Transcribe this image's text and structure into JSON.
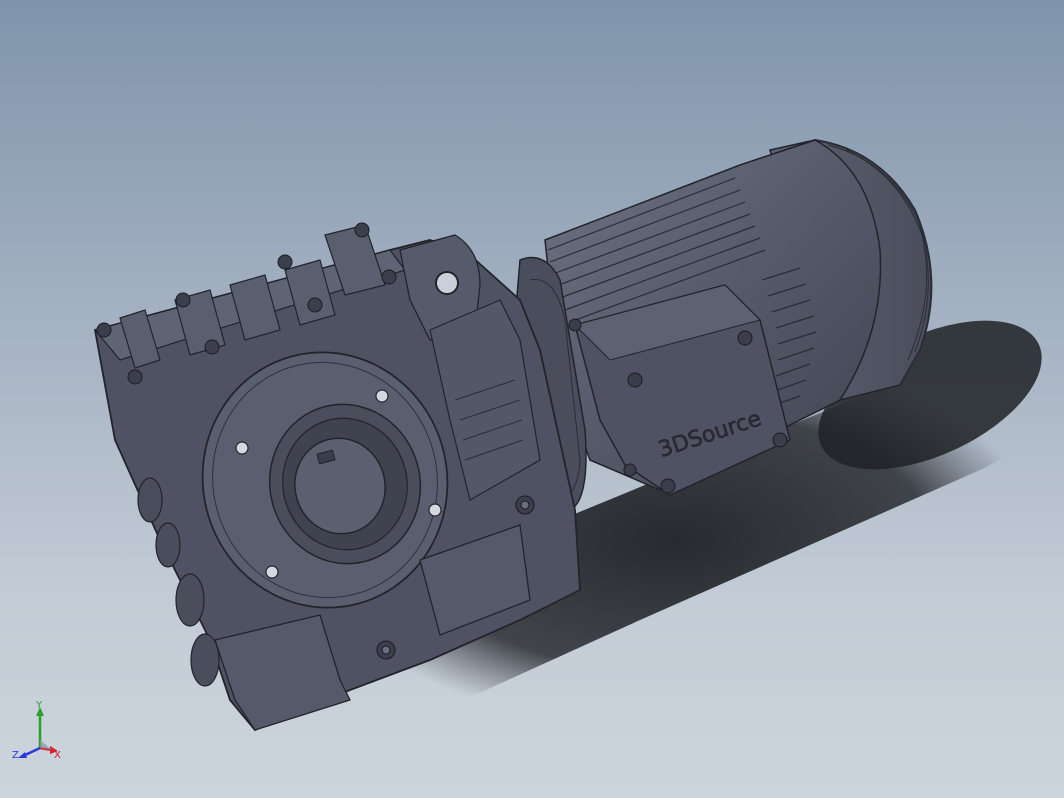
{
  "model": {
    "brand_label": "3DSource"
  },
  "triad": {
    "x_label": "X",
    "y_label": "Y",
    "z_label": "Z",
    "x_color": "#d8202a",
    "y_color": "#2aa02a",
    "z_color": "#2a3ad8"
  },
  "colors": {
    "background_top": "#7f94ab",
    "background_bottom": "#ccd4dd",
    "housing": "#505565",
    "housing_dark": "#3b3f4c",
    "housing_light": "#6a6f80",
    "shadow": "#1f2226"
  }
}
